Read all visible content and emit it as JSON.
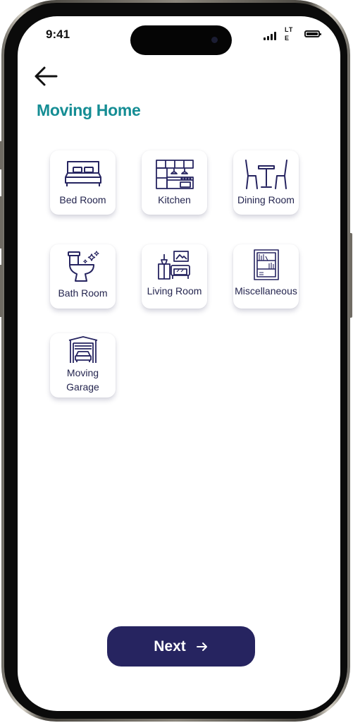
{
  "status_bar": {
    "time": "9:41",
    "network": "LTE",
    "icons": [
      "signal-icon",
      "network-lte-icon",
      "battery-icon"
    ]
  },
  "header": {
    "back_icon": "arrow-left-icon",
    "title": "Moving Home"
  },
  "rooms": [
    {
      "label": "Bed Room",
      "icon": "bed-icon"
    },
    {
      "label": "Kitchen",
      "icon": "kitchen-icon"
    },
    {
      "label": "Dining Room",
      "icon": "dining-table-icon"
    },
    {
      "label": "Bath Room",
      "icon": "toilet-icon"
    },
    {
      "label": "Living Room",
      "icon": "living-room-icon"
    },
    {
      "label": "Miscellaneous",
      "icon": "shelf-icon"
    },
    {
      "label": "Moving Garage",
      "icon": "garage-icon"
    }
  ],
  "footer": {
    "next_label": "Next",
    "next_icon": "arrow-right-icon"
  },
  "colors": {
    "title": "#158d94",
    "card_text": "#24254f",
    "icon_stroke": "#262460",
    "button_bg": "#262460",
    "button_text": "#ffffff"
  }
}
